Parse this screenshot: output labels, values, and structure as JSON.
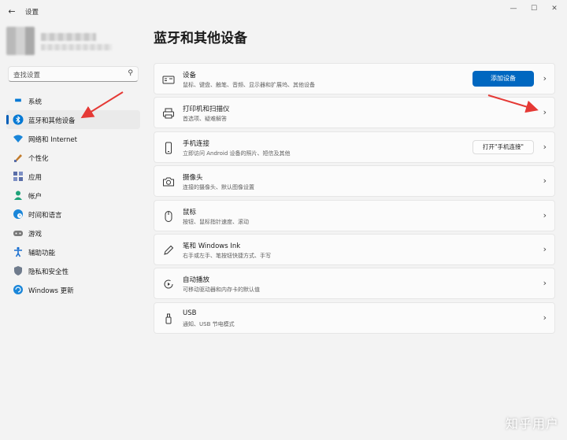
{
  "window": {
    "app_title": "设置",
    "back_icon": "back-arrow-icon",
    "controls": [
      "—",
      "☐",
      "✕"
    ]
  },
  "search": {
    "placeholder": "查找设置",
    "icon": "search-icon"
  },
  "sidebar": {
    "items": [
      {
        "label": "系统",
        "icon": "monitor-icon",
        "color": "#0078d4"
      },
      {
        "label": "蓝牙和其他设备",
        "icon": "bluetooth-icon",
        "color": "#0078d4",
        "active": true
      },
      {
        "label": "网络和 Internet",
        "icon": "wifi-icon",
        "color": "#1a86d9"
      },
      {
        "label": "个性化",
        "icon": "brush-icon",
        "color": "#c27b2b"
      },
      {
        "label": "应用",
        "icon": "apps-icon",
        "color": "#5a6ea8"
      },
      {
        "label": "帐户",
        "icon": "account-icon",
        "color": "#1fa37a"
      },
      {
        "label": "时间和语言",
        "icon": "globe-clock-icon",
        "color": "#1a86d9"
      },
      {
        "label": "游戏",
        "icon": "gamepad-icon",
        "color": "#6f6f6f"
      },
      {
        "label": "辅助功能",
        "icon": "accessibility-icon",
        "color": "#1a6fd0"
      },
      {
        "label": "隐私和安全性",
        "icon": "shield-icon",
        "color": "#6f7b8c"
      },
      {
        "label": "Windows 更新",
        "icon": "update-icon",
        "color": "#1a86d9"
      }
    ]
  },
  "main": {
    "title": "蓝牙和其他设备",
    "cards": [
      {
        "title": "设备",
        "sub": "鼠标、键盘、触笔、音频、显示器和扩展坞、其他设备",
        "icon": "devices-icon",
        "button": "添加设备"
      },
      {
        "title": "打印机和扫描仪",
        "sub": "首选项、疑难解答",
        "icon": "printer-icon"
      },
      {
        "title": "手机连接",
        "sub": "立即访问 Android 设备的照片、短信及其他",
        "icon": "phone-icon",
        "button": "打开\"手机连接\""
      },
      {
        "title": "摄像头",
        "sub": "连接的摄像头、默认图像设置",
        "icon": "camera-icon"
      },
      {
        "title": "鼠标",
        "sub": "按钮、鼠标指针速度、滚动",
        "icon": "mouse-icon"
      },
      {
        "title": "笔和 Windows Ink",
        "sub": "右手或左手、笔按钮快捷方式、手写",
        "icon": "pen-icon"
      },
      {
        "title": "自动播放",
        "sub": "可移动驱动器和内存卡的默认值",
        "icon": "autoplay-icon"
      },
      {
        "title": "USB",
        "sub": "通知、USB 节电模式",
        "icon": "usb-icon"
      }
    ]
  },
  "watermark": "知乎用户",
  "colors": {
    "accent": "#0067c0",
    "annotation_arrow": "#e53935"
  }
}
